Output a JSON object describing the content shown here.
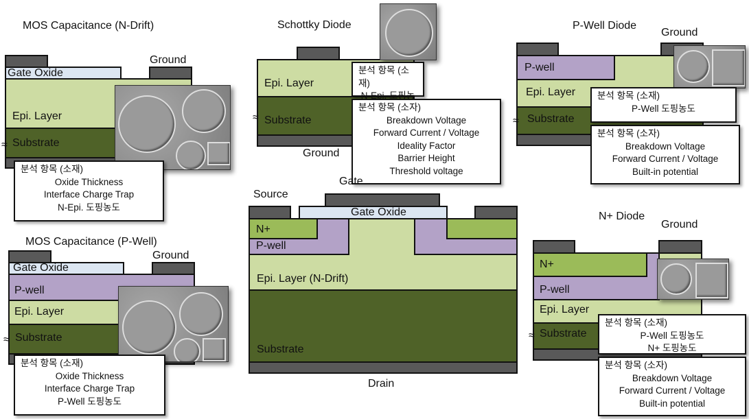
{
  "mos_ndrift": {
    "title": "MOS Capacitance (N-Drift)",
    "gate_oxide": "Gate Oxide",
    "ground": "Ground",
    "epi": "Epi. Layer",
    "substrate": "Substrate",
    "box": {
      "header": "분석 항목 (소재)",
      "items": [
        "Oxide Thickness",
        "Interface Charge Trap",
        "N-Epi. 도핑농도"
      ]
    }
  },
  "mos_pwell": {
    "title": "MOS Capacitance (P-Well)",
    "gate_oxide": "Gate Oxide",
    "ground": "Ground",
    "pwell": "P-well",
    "epi": "Epi. Layer",
    "substrate": "Substrate",
    "box": {
      "header": "분석 항목 (소재)",
      "items": [
        "Oxide Thickness",
        "Interface Charge Trap",
        "P-Well 도핑농도"
      ]
    }
  },
  "schottky": {
    "title": "Schottky Diode",
    "epi": "Epi. Layer",
    "substrate": "Substrate",
    "ground": "Ground",
    "box1": {
      "header": "분석 항목 (소재)",
      "items": [
        "N-Epi. 도핑농도"
      ]
    },
    "box2": {
      "header": "분석 항목 (소자)",
      "items": [
        "Breakdown Voltage",
        "Forward Current / Voltage",
        "Ideality  Factor",
        "Barrier Height",
        "Threshold voltage"
      ]
    }
  },
  "pwell_diode": {
    "title": "P-Well Diode",
    "ground": "Ground",
    "pwell": "P-well",
    "epi": "Epi. Layer",
    "substrate": "Substrate",
    "box1": {
      "header": "분석 항목 (소재)",
      "items": [
        "P-Well 도핑농도"
      ]
    },
    "box2": {
      "header": "분석 항목 (소자)",
      "items": [
        "Breakdown Voltage",
        "Forward Current / Voltage",
        "Built-in potential"
      ]
    }
  },
  "mosfet": {
    "gate": "Gate",
    "source": "Source",
    "drain": "Drain",
    "gate_oxide": "Gate Oxide",
    "nplus": "N+",
    "pwell": "P-well",
    "epi": "Epi. Layer (N-Drift)",
    "substrate": "Substrate"
  },
  "nplus_diode": {
    "title": "N+ Diode",
    "ground": "Ground",
    "nplus": "N+",
    "pwell": "P-well",
    "epi": "Epi. Layer",
    "substrate": "Substrate",
    "box1": {
      "header": "분석 항목 (소재)",
      "items": [
        "P-Well 도핑농도",
        "N+ 도핑농도"
      ]
    },
    "box2": {
      "header": "분석 항목 (소자)",
      "items": [
        "Breakdown Voltage",
        "Forward Current / Voltage",
        "Built-in potential"
      ]
    }
  },
  "symbols": {
    "break": "≈"
  },
  "colors": {
    "metal": "#595959",
    "oxide": "#dce6f2",
    "epi": "#cddca3",
    "substrate": "#4f6228",
    "nplus": "#9bbb59",
    "pwell": "#b3a2c7"
  }
}
